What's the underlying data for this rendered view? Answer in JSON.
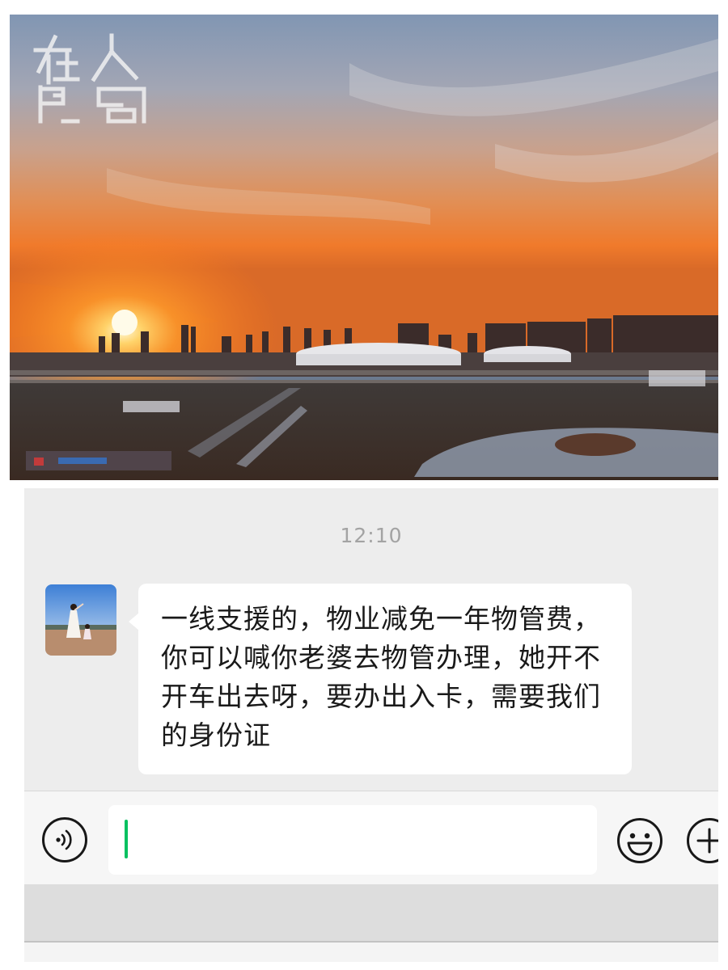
{
  "photo": {
    "watermark_text": "在人間"
  },
  "chat": {
    "timestamp": "12:10",
    "message": {
      "sender": "contact",
      "text": "一线支援的，物业减免一年物管费，你可以喊你老婆去物管办理，她开不开车出去呀，要办出入卡，需要我们的身份证"
    },
    "input": {
      "value": "",
      "icons": [
        "voice-icon",
        "emoji-icon",
        "plus-icon"
      ]
    }
  },
  "colors": {
    "chat_background": "#ededed",
    "bubble": "#ffffff",
    "caret": "#07c160",
    "timestamp": "#a3a3a3"
  }
}
